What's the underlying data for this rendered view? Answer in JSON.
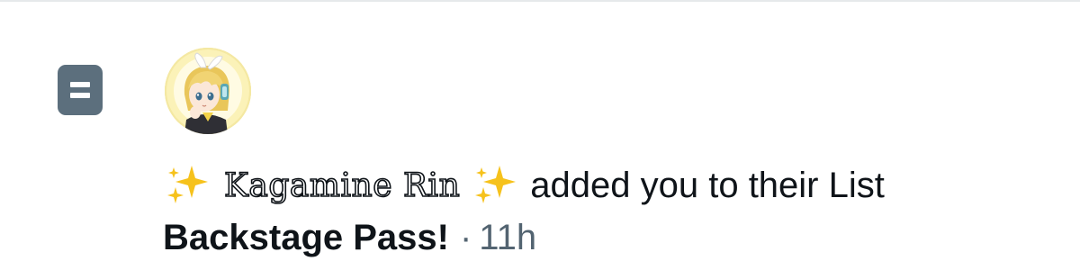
{
  "notification": {
    "user_name": "Kagamine Rin",
    "action_text": "added you to their List",
    "list_name": "Backstage Pass!",
    "separator": "·",
    "timestamp": "11h",
    "icons": {
      "type_icon": "list-icon",
      "left_emoji": "sparkles-icon",
      "right_emoji": "sparkles-icon",
      "avatar": "avatar-image"
    }
  },
  "colors": {
    "text_primary": "#0f1419",
    "text_secondary": "#536471",
    "list_icon_bg": "#5c6f7d",
    "sparkle_gold": "#f6c21c",
    "divider": "#e6e9eb"
  }
}
